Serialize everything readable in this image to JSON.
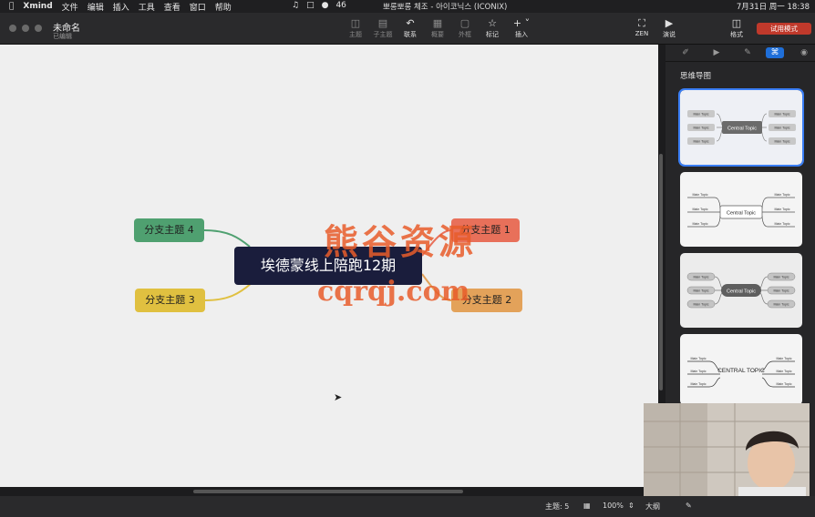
{
  "menubar": {
    "app": "Xmind",
    "items": [
      "文件",
      "编辑",
      "插入",
      "工具",
      "查看",
      "窗口",
      "帮助"
    ],
    "tray_count": "46",
    "now_playing": "뽀롱뽀롱 체조 - 아이코닉스 (ICONIX)",
    "clock": "7月31日 周一 18:38"
  },
  "titlebar": {
    "title": "未命名",
    "subtitle": "已编辑",
    "tools": [
      "主题",
      "子主题",
      "联系",
      "概要",
      "外框",
      "标记",
      "插入"
    ],
    "right_tools": [
      "ZEN",
      "演说",
      "格式"
    ],
    "trial_button": "试用模式"
  },
  "mindmap": {
    "central": "埃德蒙线上陪跑12期",
    "branches": [
      "分支主题 1",
      "分支主题 2",
      "分支主题 3",
      "分支主题 4"
    ],
    "colors": {
      "central": "#1a1d3c",
      "b1": "#e8705a",
      "b2": "#e3a25a",
      "b3": "#e0c040",
      "b4": "#4fa070"
    }
  },
  "watermark": {
    "line1": "熊谷资源",
    "line2": "cqrqj.com"
  },
  "sidebar": {
    "title": "思维导图",
    "cards": [
      {
        "central": "Central Topic",
        "topic": "Main Topic"
      },
      {
        "central": "Central Topic",
        "topic": "Main Topic"
      },
      {
        "central": "Central Topic",
        "topic": "Main Topic"
      },
      {
        "central": "CENTRAL TOPIC",
        "topic": "Main Topic"
      }
    ]
  },
  "status": {
    "topics": "主题: 5",
    "zoom": "100%",
    "outline": "大纲"
  }
}
